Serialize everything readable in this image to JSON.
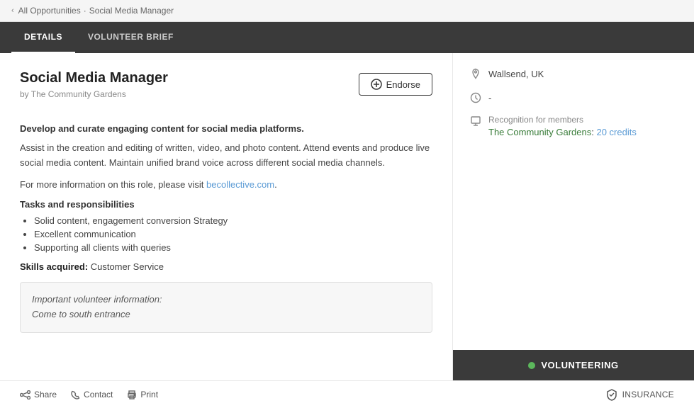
{
  "breadcrumb": {
    "back_icon": "‹",
    "link_text": "All Opportunities",
    "separator": "·",
    "current": "Social Media Manager"
  },
  "tabs": [
    {
      "label": "Details",
      "active": true
    },
    {
      "label": "Volunteer Brief",
      "active": false
    }
  ],
  "job": {
    "title": "Social Media Manager",
    "org": "by The Community Gardens",
    "endorse_label": "Endorse",
    "description_bold": "Develop and curate engaging content for social media platforms.",
    "para1": "Assist in the creation and editing of written, video, and photo content. Attend events and produce live social media content. Maintain unified brand voice across different social media channels.",
    "para2_prefix": "For more information on this role, please visit ",
    "para2_link_text": "becollective.com",
    "para2_link_href": "becollective.com",
    "para2_suffix": ".",
    "tasks_heading": "Tasks and responsibilities",
    "tasks": [
      "Solid content, engagement conversion Strategy",
      "Excellent communication",
      "Supporting all clients with queries"
    ],
    "skills_label": "Skills acquired:",
    "skills_value": "Customer Service",
    "info_box_line1": "Important volunteer information:",
    "info_box_line2": "Come to south entrance"
  },
  "footer": {
    "share_label": "Share",
    "contact_label": "Contact",
    "print_label": "Print",
    "insurance_label": "INSURANCE"
  },
  "sidebar": {
    "location": "Wallsend, UK",
    "time": "-",
    "recognition_label": "Recognition for members",
    "org_name": "The Community Gardens",
    "credits_prefix": ": ",
    "credits_value": "20 credits",
    "volunteering_label": "VOLUNTEERING"
  }
}
